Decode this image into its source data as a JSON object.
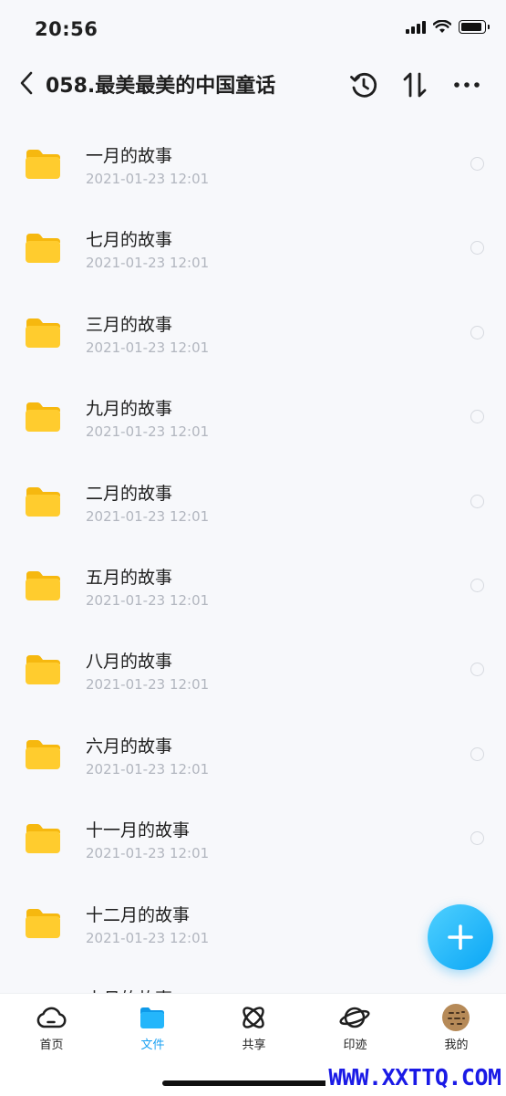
{
  "status_bar": {
    "time": "20:56"
  },
  "header": {
    "title": "058.最美最美的中国童话"
  },
  "files": [
    {
      "name": "一月的故事",
      "date": "2021-01-23 12:01"
    },
    {
      "name": "七月的故事",
      "date": "2021-01-23 12:01"
    },
    {
      "name": "三月的故事",
      "date": "2021-01-23 12:01"
    },
    {
      "name": "九月的故事",
      "date": "2021-01-23 12:01"
    },
    {
      "name": "二月的故事",
      "date": "2021-01-23 12:01"
    },
    {
      "name": "五月的故事",
      "date": "2021-01-23 12:01"
    },
    {
      "name": "八月的故事",
      "date": "2021-01-23 12:01"
    },
    {
      "name": "六月的故事",
      "date": "2021-01-23 12:01"
    },
    {
      "name": "十一月的故事",
      "date": "2021-01-23 12:01"
    },
    {
      "name": "十二月的故事",
      "date": "2021-01-23 12:01"
    },
    {
      "name": "十月的故事",
      "date": ""
    }
  ],
  "tabs": [
    {
      "label": "首页",
      "icon": "cloud-home-icon"
    },
    {
      "label": "文件",
      "icon": "folder-icon"
    },
    {
      "label": "共享",
      "icon": "share-orbit-icon"
    },
    {
      "label": "印迹",
      "icon": "planet-icon"
    },
    {
      "label": "我的",
      "icon": "avatar"
    }
  ],
  "active_tab": "文件",
  "colors": {
    "accent": "#1aa1f3",
    "folder": "#ffc928",
    "date_text": "#b2b6bf"
  },
  "watermark": "WWW.XXTTQ.COM"
}
